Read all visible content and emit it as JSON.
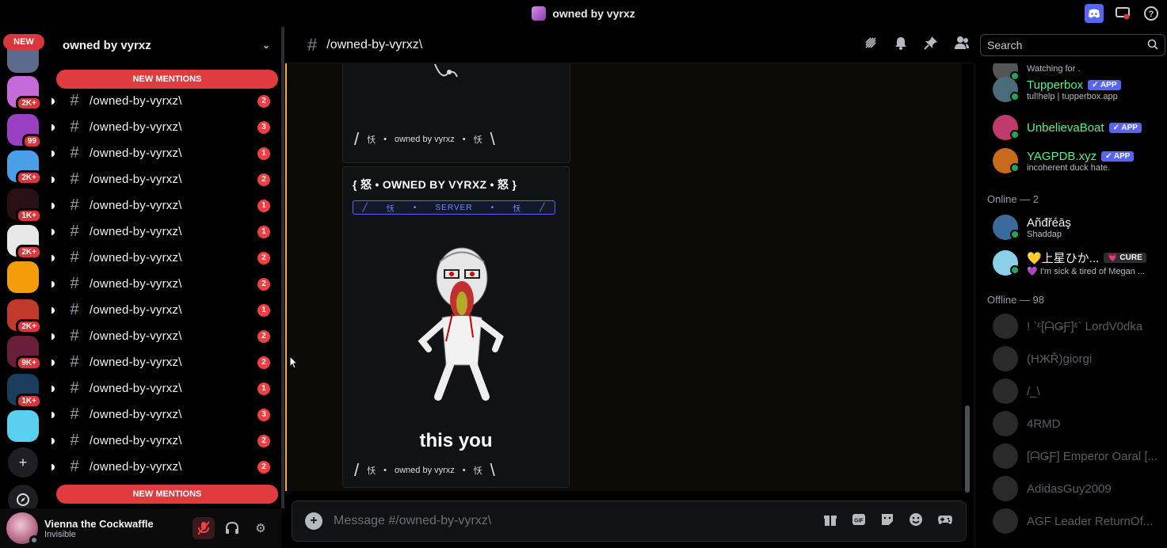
{
  "window": {
    "title": "owned by vyrxz"
  },
  "guilds": {
    "new_label": "NEW",
    "items": [
      {
        "badge": "",
        "color": "#5a6b8c"
      },
      {
        "badge": "2K+",
        "color": "#c46bd9"
      },
      {
        "badge": "99",
        "color": "#9b3fc2"
      },
      {
        "badge": "2K+",
        "color": "#4aa0e8"
      },
      {
        "badge": "1K+",
        "color": "#2a0f14"
      },
      {
        "badge": "2K+",
        "color": "#e8e8e8"
      },
      {
        "badge": "",
        "color": "#f59c0b"
      },
      {
        "badge": "2K+",
        "color": "#c0392b"
      },
      {
        "badge": "9K+",
        "color": "#6b1e3a"
      },
      {
        "badge": "1K+",
        "color": "#1a3d5c"
      },
      {
        "badge": "",
        "color": "#5ad0f0"
      }
    ]
  },
  "sidebar": {
    "server_name": "owned by vyrxz",
    "new_mentions_label": "NEW MENTIONS",
    "channels": [
      {
        "name": "/owned-by-vyrxz\\",
        "count": "2"
      },
      {
        "name": "/owned-by-vyrxz\\",
        "count": "3"
      },
      {
        "name": "/owned-by-vyrxz\\",
        "count": "1"
      },
      {
        "name": "/owned-by-vyrxz\\",
        "count": "2"
      },
      {
        "name": "/owned-by-vyrxz\\",
        "count": "1"
      },
      {
        "name": "/owned-by-vyrxz\\",
        "count": "1"
      },
      {
        "name": "/owned-by-vyrxz\\",
        "count": "2"
      },
      {
        "name": "/owned-by-vyrxz\\",
        "count": "2"
      },
      {
        "name": "/owned-by-vyrxz\\",
        "count": "1"
      },
      {
        "name": "/owned-by-vyrxz\\",
        "count": "2"
      },
      {
        "name": "/owned-by-vyrxz\\",
        "count": "2"
      },
      {
        "name": "/owned-by-vyrxz\\",
        "count": "1"
      },
      {
        "name": "/owned-by-vyrxz\\",
        "count": "3"
      },
      {
        "name": "/owned-by-vyrxz\\",
        "count": "2"
      },
      {
        "name": "/owned-by-vyrxz\\",
        "count": "2"
      }
    ]
  },
  "user": {
    "name": "Vienna the Cockwaffle",
    "status": "Invisible"
  },
  "chat": {
    "channel": "/owned-by-vyrxz\\",
    "search_placeholder": "Search",
    "embed_footer": "owned by vyrxz",
    "embed_footer_glyph": "㤇",
    "embed_title": "{ 怒 • OWNED BY VYRXZ • 怒 }",
    "server_bar": "SERVER",
    "server_bar_glyph": "㤇",
    "caption": "this you",
    "composer_placeholder": "Message #/owned-by-vyrxz\\"
  },
  "members": {
    "bots": [
      {
        "name": "",
        "sub": "Watching for .",
        "color": "#f2f3f5"
      },
      {
        "name": "Tupperbox",
        "tag": "✓ APP",
        "sub": "tul!help | tupperbox.app",
        "color": "#57f287"
      },
      {
        "name": "UnbelievaBoat",
        "tag": "✓ APP",
        "sub": "",
        "color": "#57f287"
      },
      {
        "name": "YAGPDB.xyz",
        "tag": "✓ APP",
        "sub": "incoherent duck hate.",
        "color": "#57f287"
      }
    ],
    "online_label": "Online — 2",
    "online": [
      {
        "name": "Añđřéāş",
        "sub": "Shaddap"
      },
      {
        "name": "💛上星ひか...",
        "tag": "💗 CURE",
        "sub": "💜 I'm sick & tired of Megan ..."
      }
    ],
    "offline_label": "Offline — 98",
    "offline": [
      {
        "name": "! `ᵋ[ᗩǤƑ]ᵋ` LordV0dka"
      },
      {
        "name": "(HЖŘ)giorgi"
      },
      {
        "name": "/_\\"
      },
      {
        "name": "4RMD"
      },
      {
        "name": "[ᗩǤƑ] Emperor Oaral [..."
      },
      {
        "name": "AdidasGuy2009"
      },
      {
        "name": "AGF Leader ReturnOf..."
      }
    ]
  },
  "colors": {
    "accent": "#5865f2",
    "mention": "#da373c",
    "online": "#23a55a",
    "highlight": "#f0b232"
  }
}
